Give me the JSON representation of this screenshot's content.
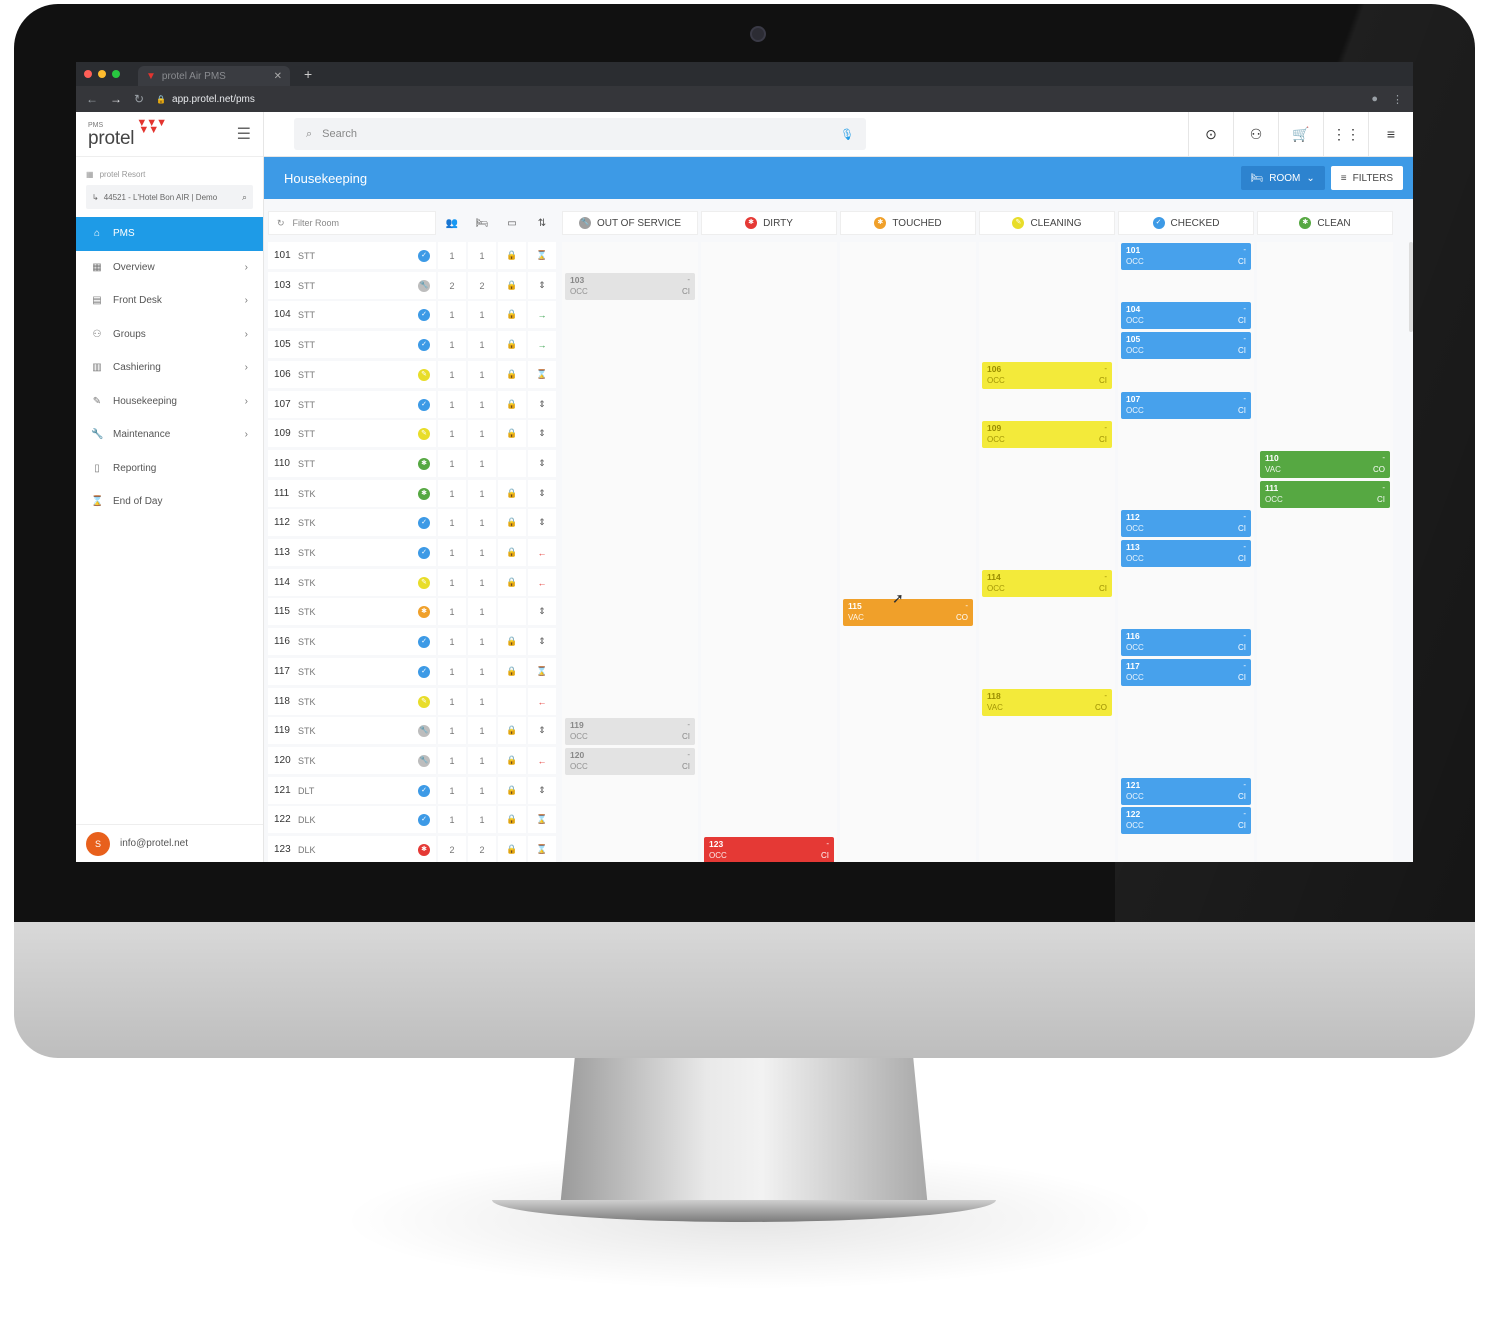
{
  "browser": {
    "tab_title": "protel Air PMS",
    "url": "app.protel.net/pms"
  },
  "sidebar": {
    "brand_small": "PMS",
    "brand_name": "protel",
    "resort": "protel Resort",
    "hotel": "44521 - L'Hotel Bon AIR | Demo",
    "items": [
      {
        "label": "PMS",
        "icon": "home-icon",
        "active": true,
        "chevron": false
      },
      {
        "label": "Overview",
        "icon": "grid-icon",
        "active": false,
        "chevron": true
      },
      {
        "label": "Front Desk",
        "icon": "desk-icon",
        "active": false,
        "chevron": true
      },
      {
        "label": "Groups",
        "icon": "group-icon",
        "active": false,
        "chevron": true
      },
      {
        "label": "Cashiering",
        "icon": "cash-icon",
        "active": false,
        "chevron": true
      },
      {
        "label": "Housekeeping",
        "icon": "brush-icon",
        "active": false,
        "chevron": true
      },
      {
        "label": "Maintenance",
        "icon": "wrench-icon",
        "active": false,
        "chevron": true
      },
      {
        "label": "Reporting",
        "icon": "report-icon",
        "active": false,
        "chevron": false
      },
      {
        "label": "End of Day",
        "icon": "hourglass-icon",
        "active": false,
        "chevron": false
      }
    ],
    "user_initial": "S",
    "user_email": "info@protel.net"
  },
  "topbar": {
    "search_placeholder": "Search"
  },
  "housekeeping": {
    "title": "Housekeeping",
    "room_button": "ROOM",
    "filters_button": "FILTERS",
    "filter_placeholder": "Filter Room",
    "columns": [
      {
        "label": "OUT OF SERVICE",
        "color": "#9e9e9e",
        "glyph": "🔧"
      },
      {
        "label": "DIRTY",
        "color": "#e53935",
        "glyph": "✱"
      },
      {
        "label": "TOUCHED",
        "color": "#f0a02a",
        "glyph": "✱"
      },
      {
        "label": "CLEANING",
        "color": "#e8dd2a",
        "glyph": "✎"
      },
      {
        "label": "CHECKED",
        "color": "#3d9ae6",
        "glyph": "✓"
      },
      {
        "label": "CLEAN",
        "color": "#56a842",
        "glyph": "✱"
      }
    ],
    "rooms": [
      {
        "num": "101",
        "type": "STT",
        "status": "checked",
        "a": "1",
        "b": "1",
        "lock": true,
        "move": "hourglass",
        "col": 4,
        "occ": "OCC",
        "tag": "CI"
      },
      {
        "num": "103",
        "type": "STT",
        "status": "oos",
        "a": "2",
        "b": "2",
        "lock": true,
        "move": "split",
        "col": 0,
        "occ": "OCC",
        "tag": "CI"
      },
      {
        "num": "104",
        "type": "STT",
        "status": "checked",
        "a": "1",
        "b": "1",
        "lock": true,
        "move": "arrive",
        "col": 4,
        "occ": "OCC",
        "tag": "CI"
      },
      {
        "num": "105",
        "type": "STT",
        "status": "checked",
        "a": "1",
        "b": "1",
        "lock": true,
        "move": "arrive",
        "col": 4,
        "occ": "OCC",
        "tag": "CI"
      },
      {
        "num": "106",
        "type": "STT",
        "status": "cleaning",
        "a": "1",
        "b": "1",
        "lock": true,
        "move": "hourglass",
        "col": 3,
        "occ": "OCC",
        "tag": "CI"
      },
      {
        "num": "107",
        "type": "STT",
        "status": "checked",
        "a": "1",
        "b": "1",
        "lock": true,
        "move": "split",
        "col": 4,
        "occ": "OCC",
        "tag": "CI"
      },
      {
        "num": "109",
        "type": "STT",
        "status": "cleaning",
        "a": "1",
        "b": "1",
        "lock": true,
        "move": "split",
        "col": 3,
        "occ": "OCC",
        "tag": "CI"
      },
      {
        "num": "110",
        "type": "STT",
        "status": "clean",
        "a": "1",
        "b": "1",
        "lock": false,
        "move": "split",
        "col": 5,
        "occ": "VAC",
        "tag": "CO"
      },
      {
        "num": "111",
        "type": "STK",
        "status": "clean",
        "a": "1",
        "b": "1",
        "lock": true,
        "move": "split",
        "col": 5,
        "occ": "OCC",
        "tag": "CI"
      },
      {
        "num": "112",
        "type": "STK",
        "status": "checked",
        "a": "1",
        "b": "1",
        "lock": true,
        "move": "split",
        "col": 4,
        "occ": "OCC",
        "tag": "CI"
      },
      {
        "num": "113",
        "type": "STK",
        "status": "checked",
        "a": "1",
        "b": "1",
        "lock": true,
        "move": "depart",
        "col": 4,
        "occ": "OCC",
        "tag": "CI"
      },
      {
        "num": "114",
        "type": "STK",
        "status": "cleaning",
        "a": "1",
        "b": "1",
        "lock": true,
        "move": "depart",
        "col": 3,
        "occ": "OCC",
        "tag": "CI"
      },
      {
        "num": "115",
        "type": "STK",
        "status": "touched",
        "a": "1",
        "b": "1",
        "lock": false,
        "move": "split",
        "col": 2,
        "occ": "VAC",
        "tag": "CO"
      },
      {
        "num": "116",
        "type": "STK",
        "status": "checked",
        "a": "1",
        "b": "1",
        "lock": true,
        "move": "split",
        "col": 4,
        "occ": "OCC",
        "tag": "CI"
      },
      {
        "num": "117",
        "type": "STK",
        "status": "checked",
        "a": "1",
        "b": "1",
        "lock": true,
        "move": "hourglass",
        "col": 4,
        "occ": "OCC",
        "tag": "CI"
      },
      {
        "num": "118",
        "type": "STK",
        "status": "cleaning",
        "a": "1",
        "b": "1",
        "lock": false,
        "move": "depart",
        "col": 3,
        "occ": "VAC",
        "tag": "CO"
      },
      {
        "num": "119",
        "type": "STK",
        "status": "oos",
        "a": "1",
        "b": "1",
        "lock": true,
        "move": "split",
        "col": 0,
        "occ": "OCC",
        "tag": "CI"
      },
      {
        "num": "120",
        "type": "STK",
        "status": "oos",
        "a": "1",
        "b": "1",
        "lock": true,
        "move": "depart",
        "col": 0,
        "occ": "OCC",
        "tag": "CI"
      },
      {
        "num": "121",
        "type": "DLT",
        "status": "checked",
        "a": "1",
        "b": "1",
        "lock": true,
        "move": "split",
        "col": 4,
        "occ": "OCC",
        "tag": "CI"
      },
      {
        "num": "122",
        "type": "DLK",
        "status": "checked",
        "a": "1",
        "b": "1",
        "lock": true,
        "move": "hourglass",
        "col": 4,
        "occ": "OCC",
        "tag": "CI"
      },
      {
        "num": "123",
        "type": "DLK",
        "status": "dirty",
        "a": "2",
        "b": "2",
        "lock": true,
        "move": "hourglass",
        "col": 1,
        "occ": "OCC",
        "tag": "CI"
      }
    ]
  }
}
